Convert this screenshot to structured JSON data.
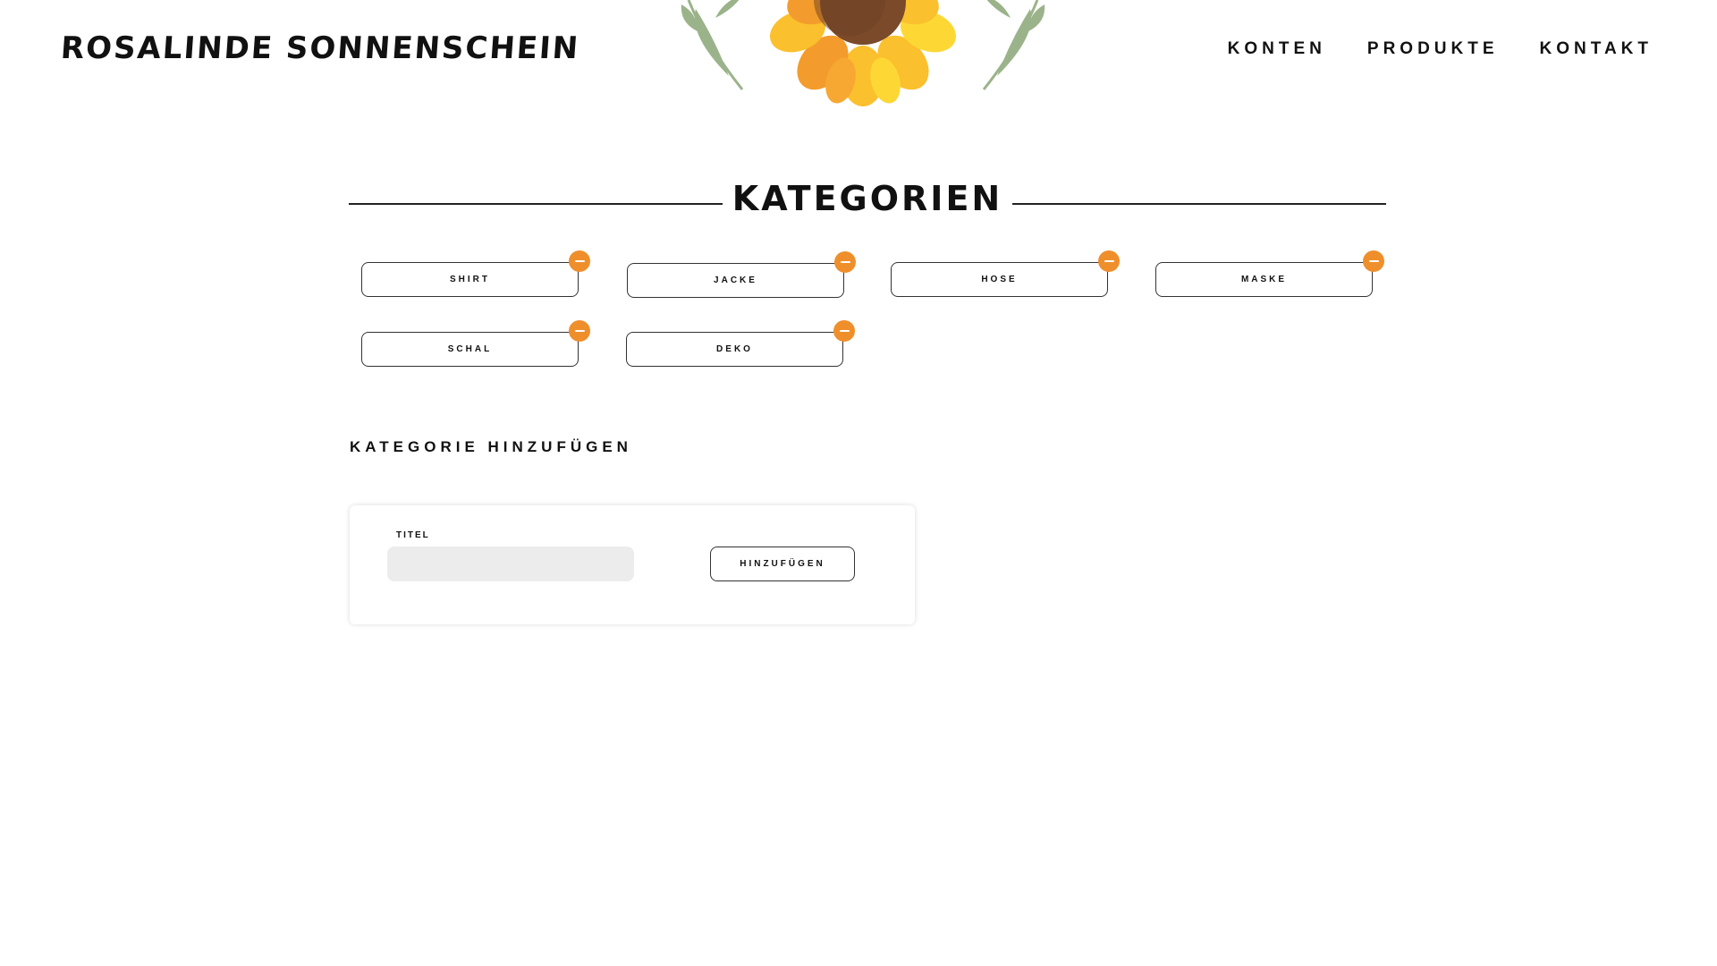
{
  "header": {
    "logo": "ROSALINDE SONNENSCHEIN",
    "nav": [
      {
        "label": "KONTEN"
      },
      {
        "label": "PRODUKTE"
      },
      {
        "label": "KONTAKT"
      }
    ]
  },
  "main": {
    "title": "KATEGORIEN",
    "categories": [
      {
        "label": "SHIRT"
      },
      {
        "label": "JACKE"
      },
      {
        "label": "HOSE"
      },
      {
        "label": "MASKE"
      },
      {
        "label": "SCHAL"
      },
      {
        "label": "DEKO"
      }
    ],
    "add_section": {
      "heading": "KATEGORIE HINZUFÜGEN",
      "field_label": "TITEL",
      "field_value": "",
      "button_label": "HINZUFÜGEN"
    }
  },
  "colors": {
    "accent": "#ef8f2c",
    "petal_yellow": "#fbc02d",
    "petal_orange": "#f39c2d",
    "center_brown": "#7b4a2a",
    "leaf_green": "#9bb38a"
  },
  "icons": {
    "remove": "minus-circle-icon",
    "decoration": "sunflower-icon"
  }
}
